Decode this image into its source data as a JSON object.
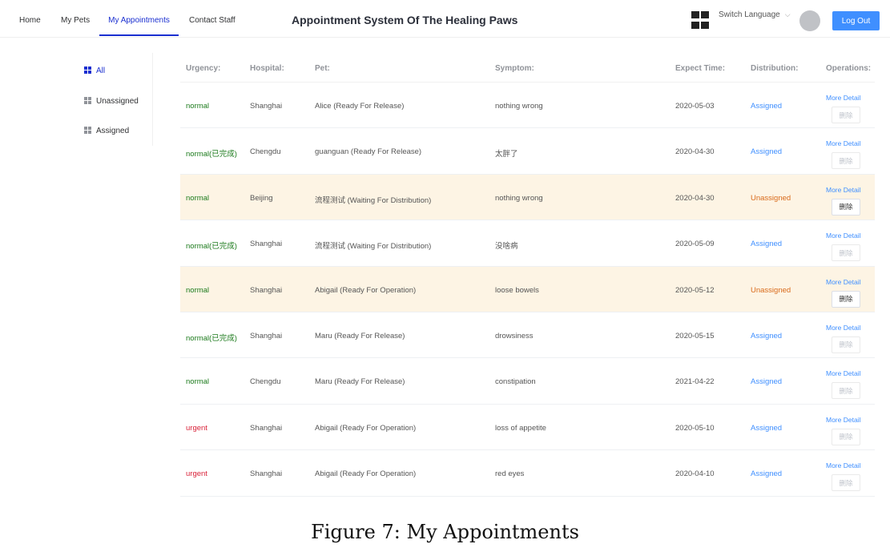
{
  "header": {
    "nav": [
      "Home",
      "My Pets",
      "My Appointments",
      "Contact Staff"
    ],
    "active_nav": "My Appointments",
    "title": "Appointment System Of The Healing Paws",
    "switch_language": "Switch Language",
    "logout": "Log Out"
  },
  "filters": {
    "items": [
      "All",
      "Unassigned",
      "Assigned"
    ],
    "active": "All"
  },
  "table": {
    "columns": [
      "Urgency:",
      "Hospital:",
      "Pet:",
      "Symptom:",
      "Expect Time:",
      "Distribution:",
      "Operations:"
    ],
    "rows": [
      {
        "urgency": "normal",
        "hospital": "Shanghai",
        "pet": "Alice (Ready For Release)",
        "symptom": "nothing wrong",
        "expect_time": "2020-05-03",
        "distribution": "Assigned",
        "more": "More Detail",
        "delete": "删除"
      },
      {
        "urgency": "normal(已完成)",
        "hospital": "Chengdu",
        "pet": "guanguan (Ready For Release)",
        "symptom": "太胖了",
        "expect_time": "2020-04-30",
        "distribution": "Assigned",
        "more": "More Detail",
        "delete": "删除"
      },
      {
        "urgency": "normal",
        "hospital": "Beijing",
        "pet": "流程测试 (Waiting For Distribution)",
        "symptom": "nothing wrong",
        "expect_time": "2020-04-30",
        "distribution": "Unassigned",
        "more": "More Detail",
        "delete": "删除"
      },
      {
        "urgency": "normal(已完成)",
        "hospital": "Shanghai",
        "pet": "流程测试 (Waiting For Distribution)",
        "symptom": "没啥病",
        "expect_time": "2020-05-09",
        "distribution": "Assigned",
        "more": "More Detail",
        "delete": "删除"
      },
      {
        "urgency": "normal",
        "hospital": "Shanghai",
        "pet": "Abigail (Ready For Operation)",
        "symptom": "loose bowels",
        "expect_time": "2020-05-12",
        "distribution": "Unassigned",
        "more": "More Detail",
        "delete": "删除"
      },
      {
        "urgency": "normal(已完成)",
        "hospital": "Shanghai",
        "pet": "Maru (Ready For Release)",
        "symptom": "drowsiness",
        "expect_time": "2020-05-15",
        "distribution": "Assigned",
        "more": "More Detail",
        "delete": "删除"
      },
      {
        "urgency": "normal",
        "hospital": "Chengdu",
        "pet": "Maru (Ready For Release)",
        "symptom": "constipation",
        "expect_time": "2021-04-22",
        "distribution": "Assigned",
        "more": "More Detail",
        "delete": "删除"
      },
      {
        "urgency": "urgent",
        "hospital": "Shanghai",
        "pet": "Abigail (Ready For Operation)",
        "symptom": "loss of appetite",
        "expect_time": "2020-05-10",
        "distribution": "Assigned",
        "more": "More Detail",
        "delete": "删除"
      },
      {
        "urgency": "urgent",
        "hospital": "Shanghai",
        "pet": "Abigail (Ready For Operation)",
        "symptom": "red eyes",
        "expect_time": "2020-04-10",
        "distribution": "Assigned",
        "more": "More Detail",
        "delete": "删除"
      }
    ]
  },
  "colors": {
    "accent": "#1a2fd0",
    "link_blue": "#3f8fff",
    "normal_green": "#1b7a1b",
    "urgent_red": "#d9233a",
    "unassigned_orange": "#d96a1a",
    "unassigned_row_bg": "#fdf4e4"
  },
  "icons": [
    "grid-menu-icon",
    "chevron-down-icon",
    "grid-filter-icon"
  ],
  "caption": "Figure 7: My Appointments"
}
